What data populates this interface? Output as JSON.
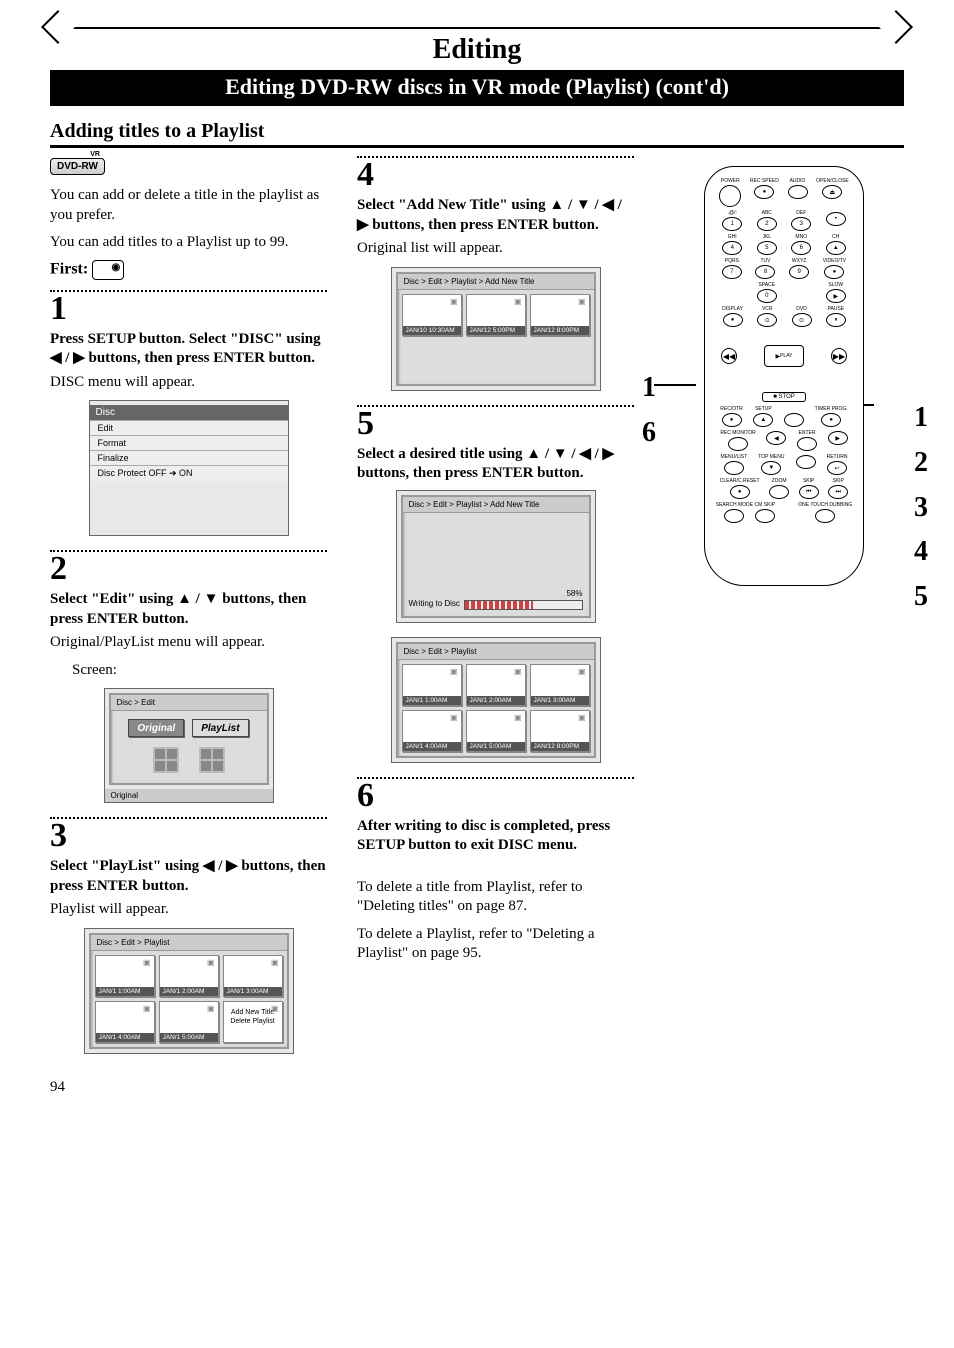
{
  "page_number": "94",
  "header": {
    "title": "Editing"
  },
  "banner": "Editing DVD-RW discs in VR mode (Playlist) (cont'd)",
  "section": "Adding titles to a Playlist",
  "badge": "DVD-RW",
  "intro1": "You can add or delete a title in the playlist as you prefer.",
  "intro2": "You can add titles to a Playlist up to 99.",
  "first_label": "First:",
  "steps": {
    "s1": {
      "num": "1",
      "instr": "Press SETUP button. Select \"DISC\" using ◀ / ▶ buttons, then press ENTER button.",
      "result": "DISC menu will appear.",
      "menu_title": "Disc",
      "menu_items": [
        "Edit",
        "Format",
        "Finalize",
        "Disc Protect OFF ➜ ON"
      ]
    },
    "s2": {
      "num": "2",
      "instr": "Select \"Edit\" using ▲ / ▼ buttons, then press ENTER button.",
      "result": "Original/PlayList menu will appear.",
      "screen_label": "Screen:",
      "breadcrumb": "Disc > Edit",
      "btn_original": "Original",
      "btn_playlist": "PlayList",
      "status": "Original"
    },
    "s3": {
      "num": "3",
      "instr": "Select \"PlayList\" using ◀ / ▶ buttons, then press ENTER button.",
      "result": "Playlist will appear.",
      "breadcrumb": "Disc > Edit > Playlist",
      "thumbs": [
        "JAN/1  1:00AM",
        "JAN/1  2:00AM",
        "JAN/1  3:00AM",
        "JAN/1  4:00AM",
        "JAN/1  5:00AM"
      ],
      "opt1": "Add New Title",
      "opt2": "Delete Playlist"
    },
    "s4": {
      "num": "4",
      "instr": "Select \"Add New Title\" using ▲ / ▼ / ◀ / ▶ buttons, then press ENTER button.",
      "result": "Original list will appear.",
      "breadcrumb": "Disc > Edit > Playlist > Add New Title",
      "thumbs": [
        "JAN/10 10:30AM",
        "JAN/12  5:00PM",
        "JAN/12  8:00PM"
      ]
    },
    "s5": {
      "num": "5",
      "instr": "Select a desired title using ▲ / ▼ / ◀ / ▶ buttons, then press ENTER button.",
      "breadcrumb": "Disc > Edit > Playlist > Add New Title",
      "progress_pct": "58%",
      "progress_label": "Writing to Disc",
      "breadcrumb2": "Disc > Edit > Playlist",
      "thumbs2": [
        "JAN/1  1:00AM",
        "JAN/1  2:00AM",
        "JAN/1  3:00AM",
        "JAN/1  4:00AM",
        "JAN/1  5:00AM",
        "JAN/12  8:00PM"
      ]
    },
    "s6": {
      "num": "6",
      "instr": "After writing to disc is completed, press SETUP button to exit DISC menu.",
      "note1": "To delete a title from Playlist, refer to \"Deleting titles\" on page 87.",
      "note2": "To delete a Playlist, refer to \"Deleting a Playlist\" on page 95."
    }
  },
  "remote": {
    "row1": [
      "POWER",
      "REC SPEED",
      "AUDIO",
      "OPEN/CLOSE"
    ],
    "row2": [
      ".@/:",
      "ABC",
      "DEF",
      ""
    ],
    "row2n": [
      "1",
      "2",
      "3",
      "•"
    ],
    "row3": [
      "GHI",
      "JKL",
      "MNO",
      "CH"
    ],
    "row3n": [
      "4",
      "5",
      "6",
      "▲"
    ],
    "row4": [
      "PQRS",
      "TUV",
      "WXYZ",
      "VIDEO/TV"
    ],
    "row4n": [
      "7",
      "8",
      "9",
      "●"
    ],
    "row5l": [
      "",
      "SPACE",
      "",
      "SLOW"
    ],
    "row5n": [
      "",
      "0",
      "",
      "▶"
    ],
    "row6": [
      "DISPLAY",
      "VCR",
      "DVD",
      "PAUSE"
    ],
    "row7l": "PLAY",
    "row7s": "STOP",
    "row8": [
      "REC/OTR",
      "SETUP",
      "",
      "TIMER PROG."
    ],
    "row9": [
      "REC MONITOR",
      "",
      "ENTER",
      ""
    ],
    "row10": [
      "MENU/LIST",
      "TOP MENU",
      "",
      "RETURN"
    ],
    "row11": [
      "CLEAR/C.RESET",
      "ZOOM",
      "SKIP",
      "SKIP"
    ],
    "row12": [
      "SEARCH MODE",
      "CM SKIP",
      "",
      "ONE TOUCH DUBBING"
    ]
  },
  "callout_left": [
    "1",
    "6"
  ],
  "callout_right": [
    "1",
    "2",
    "3",
    "4",
    "5"
  ]
}
